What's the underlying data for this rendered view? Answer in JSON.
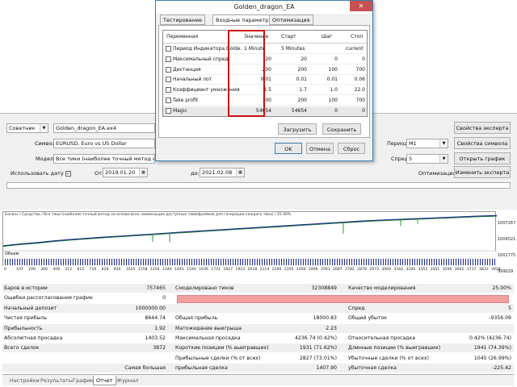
{
  "tester": {
    "expert_type": "Советник",
    "expert_file": "Golden_dragon_EA.ex4",
    "expert_props_btn": "Свойства эксперта",
    "symbol_label": "Символ:",
    "symbol_value": "EURUSD, Euro vs US Dollar",
    "period_label": "Период:",
    "period_value": "M1",
    "symbol_props_btn": "Свойства символа",
    "model_label": "Модель:",
    "model_value": "Все тики (наиболее точный метод на основе всех",
    "spread_label": "Спред:",
    "spread_value": "5",
    "open_chart_btn": "Открыть график",
    "use_date_label": "Использовать дату",
    "from_label": "От:",
    "from_value": "2019.01.20",
    "to_label": "до:",
    "to_value": "2021.02.08",
    "optimization_label": "Оптимизация",
    "edit_expert_btn": "Изменить эксперта"
  },
  "chart": {
    "header": "Баланс / Средства / Все тики (наиболее точный метод на основе всех наименьших доступных таймфреймов для генерации каждого тика) / 25.00%",
    "volume_label": "Объем",
    "y_ticks": [
      "1007267",
      "1004521",
      "1001775",
      "999029"
    ],
    "x_ticks": [
      "0",
      "107",
      "209",
      "306",
      "409",
      "512",
      "613",
      "716",
      "818",
      "920",
      "1025",
      "1158",
      "1254",
      "1349",
      "1445",
      "1540",
      "1636",
      "1731",
      "1827",
      "1923",
      "2018",
      "2114",
      "2209",
      "2305",
      "2400",
      "2496",
      "2591",
      "2687",
      "2782",
      "2878",
      "2973",
      "3069",
      "3164",
      "3260",
      "3355",
      "3451",
      "3546",
      "3642",
      "3737",
      "3833",
      "3928"
    ]
  },
  "chart_data": {
    "type": "line",
    "series": [
      {
        "name": "Баланс",
        "values": [
          1000000,
          1000500,
          1000900,
          1001400,
          1001800,
          1002150,
          1002500,
          1002800,
          1003100,
          1003400,
          1003750,
          1004050,
          1004350,
          1004650,
          1004950,
          1005250,
          1005550,
          1005850,
          1006150,
          1006450,
          1006750,
          1007050,
          1007300,
          1007500,
          1007700,
          1007900,
          1008100,
          1008300,
          1008500,
          1008644
        ]
      }
    ],
    "ylim": [
      999029,
      1008500
    ]
  },
  "report": {
    "rows": [
      [
        "Баров в истории",
        "757465",
        "Смоделировано тиков",
        "32308849",
        "Качество моделирования",
        "25.00%"
      ],
      [
        "Ошибки рассогласования графиков",
        "0",
        "",
        "",
        "",
        ""
      ],
      [
        "Начальный депозит",
        "1000000.00",
        "",
        "",
        "Спред",
        "5"
      ],
      [
        "Чистая прибыль",
        "8644.74",
        "Общая прибыль",
        "18000.83",
        "Общий убыток",
        "-9356.09"
      ],
      [
        "Прибыльность",
        "1.92",
        "Матожидание выигрыша",
        "2.23",
        "",
        ""
      ],
      [
        "Абсолютная просадка",
        "1403.52",
        "Максимальная просадка",
        "4236.74 (0.42%)",
        "Относительная просадка",
        "0.42% (4236.74)"
      ],
      [
        "Всего сделок",
        "3872",
        "Короткие позиции (% выигравших)",
        "1931 (71.62%)",
        "Длинные позиции (% выигравших)",
        "1941 (74.39%)"
      ],
      [
        "",
        "",
        "Прибыльные сделки (% от всех)",
        "2827 (73.01%)",
        "Убыточные сделки (% от всех)",
        "1045 (26.99%)"
      ],
      [
        "",
        "Самая большая",
        "прибыльная сделка",
        "1407.90",
        "убыточная сделка",
        "-225.42"
      ]
    ]
  },
  "tabs": [
    "Настройки",
    "Результаты",
    "График",
    "Отчет",
    "Журнал"
  ],
  "dialog": {
    "title": "Golden_dragon_EA",
    "close": "✕",
    "tabs": [
      "Тестирование",
      "Входные параметры",
      "Оптимизация"
    ],
    "headers": [
      "Переменная",
      "Значение",
      "Старт",
      "Шаг",
      "Стоп"
    ],
    "params": [
      [
        "Период Индикатора Golde...",
        "1 Minute",
        "5 Minutes",
        "",
        "current"
      ],
      [
        "Максимальный спред",
        "20",
        "20",
        "0",
        "0"
      ],
      [
        "Дистанция",
        "200",
        "200",
        "100",
        "700"
      ],
      [
        "Начальный лот",
        "0.01",
        "0.01",
        "0.01",
        "0.06"
      ],
      [
        "Коэффициент умножения",
        "1.5",
        "1.7",
        "1.0",
        "22.0"
      ],
      [
        "Take profit",
        "100",
        "200",
        "100",
        "700"
      ],
      [
        "Magic",
        "54654",
        "54654",
        "0",
        "0"
      ]
    ],
    "load_btn": "Загрузить",
    "save_btn": "Сохранить",
    "ok_btn": "OK",
    "cancel_btn": "Отмена",
    "reset_btn": "Сброс"
  },
  "colors": {
    "balance": "#1a2a8c",
    "equity": "#2a9a2a",
    "highlight": "#cc1111",
    "quality_bar": "#f2a0a0"
  }
}
